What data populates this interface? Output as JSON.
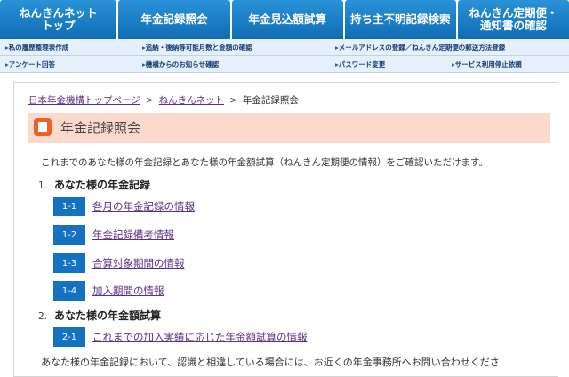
{
  "nav": {
    "tabs": [
      {
        "line1": "ねんきんネット",
        "line2": "トップ"
      },
      {
        "line1": "年金記録照会",
        "line2": ""
      },
      {
        "line1": "年金見込額試算",
        "line2": ""
      },
      {
        "line1": "持ち主不明記録検索",
        "line2": ""
      },
      {
        "line1": "ねんきん定期便・",
        "line2": "通知書の確認"
      }
    ],
    "sub_row1": [
      "私の履歴整理表作成",
      "追納・後納等可能月数と金額の確認",
      "メールアドレスの登録／ねんきん定期便の郵送方法登録"
    ],
    "sub_row2": [
      "アンケート回答",
      "機構からのお知らせ確認",
      "パスワード変更",
      "サービス利用停止依頼"
    ]
  },
  "breadcrumb": {
    "home": "日本年金機構トップページ",
    "sep": ">",
    "net": "ねんきんネット",
    "current": "年金記録照会"
  },
  "page": {
    "title": "年金記録照会",
    "intro": "これまでのあなた様の年金記録とあなた様の年金額試算（ねんきん定期便の情報）をご確認いただけます。",
    "bottom_text": "あなた様の年金記録において、認識と相違している場合には、お近くの年金事務所へお問い合わせくださ"
  },
  "sections": [
    {
      "num": "1.",
      "title": "あなた様の年金記録",
      "items": [
        {
          "code": "1-1",
          "label": "各月の年金記録の情報"
        },
        {
          "code": "1-2",
          "label": "年金記録備考情報"
        },
        {
          "code": "1-3",
          "label": "合算対象期間の情報"
        },
        {
          "code": "1-4",
          "label": "加入期間の情報"
        }
      ]
    },
    {
      "num": "2.",
      "title": "あなた様の年金額試算",
      "items": [
        {
          "code": "2-1",
          "label": "これまでの加入実績に応じた年金額試算の情報"
        }
      ]
    }
  ],
  "colors": {
    "nav_blue": "#1572c0",
    "title_bg": "#fbd9cc",
    "title_icon": "#e8622b",
    "link": "#5d2e87"
  }
}
